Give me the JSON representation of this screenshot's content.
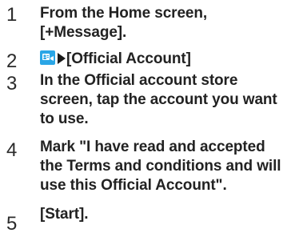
{
  "steps": [
    {
      "number": "1",
      "lines": [
        "From the Home screen,",
        "[+Message]."
      ]
    },
    {
      "number": "2",
      "icon": "official-account-icon",
      "text": "[Official Account]"
    },
    {
      "number": "3",
      "lines": [
        "In the Official account store",
        "screen, tap the account you want",
        "to use."
      ]
    },
    {
      "number": "4",
      "lines": [
        "Mark \"I have read and accepted",
        "the Terms and conditions and will",
        "use this Official Account\"."
      ]
    },
    {
      "number": "5",
      "lines": [
        "[Start]."
      ]
    }
  ],
  "colors": {
    "icon_blue": "#2aa6e6",
    "text": "#222222"
  }
}
